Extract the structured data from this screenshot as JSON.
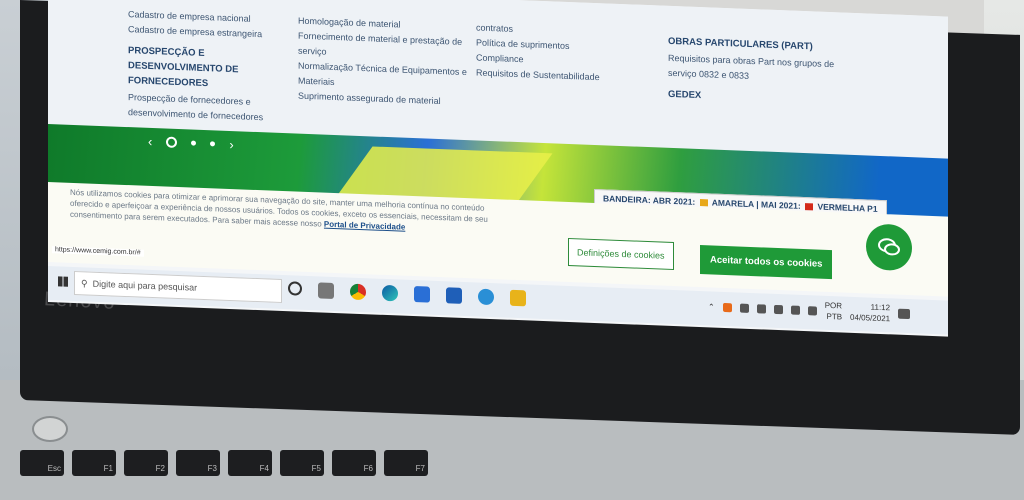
{
  "brand": "Lenovo",
  "menu": {
    "col1": [
      {
        "text": "Cadastro de empresa nacional"
      },
      {
        "text": "Cadastro de empresa estrangeira"
      },
      {
        "head": "PROSPECÇÃO E DESENVOLVIMENTO DE FORNECEDORES"
      },
      {
        "text": "Prospecção de fornecedores e desenvolvimento de fornecedores"
      }
    ],
    "col2": [
      {
        "text": "Homologação de material"
      },
      {
        "text": "Fornecimento de material e prestação de serviço"
      },
      {
        "text": "Normalização Técnica de Equipamentos e Materiais"
      },
      {
        "text": "Suprimento assegurado de material"
      }
    ],
    "col3": [
      {
        "text": "contratos"
      },
      {
        "text": "Política de suprimentos"
      },
      {
        "text": "Compliance"
      },
      {
        "text": "Requisitos de Sustentabilidade"
      }
    ],
    "col4": [
      {
        "head": "OBRAS PARTICULARES (PART)"
      },
      {
        "text": "Requisitos para obras Part nos grupos de serviço 0832 e 0833"
      },
      {
        "head": "GEDEX"
      }
    ]
  },
  "flags": {
    "label": "BANDEIRA:",
    "m1": "ABR 2021:",
    "v1": "AMARELA",
    "m2": "MAI 2021:",
    "v2": "VERMELHA P1"
  },
  "cookie": {
    "text": "Nós utilizamos cookies para otimizar e aprimorar sua navegação do site, manter uma melhoria contínua no conteúdo oferecido e aperfeiçoar a experiência de nossos usuários. Todos os cookies, exceto os essenciais, necessitam de seu consentimento para serem executados. Para saber mais acesse nosso",
    "link": "Portal de Privacidade",
    "settings_btn": "Definições de cookies",
    "accept_btn": "Aceitar todos os cookies",
    "url": "https://www.cemig.com.br/#"
  },
  "taskbar": {
    "search_placeholder": "Digite aqui para pesquisar",
    "lang_top": "POR",
    "lang_bottom": "PTB",
    "time": "11:12",
    "date": "04/05/2021"
  },
  "colors": {
    "accent_green": "#1f9a38",
    "title_blue": "#27476e",
    "amarela": "#e8a81a",
    "vermelha": "#d42a1a"
  },
  "keys": [
    "Esc",
    "F1",
    "F2",
    "F3",
    "F4",
    "F5",
    "F6",
    "F7"
  ]
}
